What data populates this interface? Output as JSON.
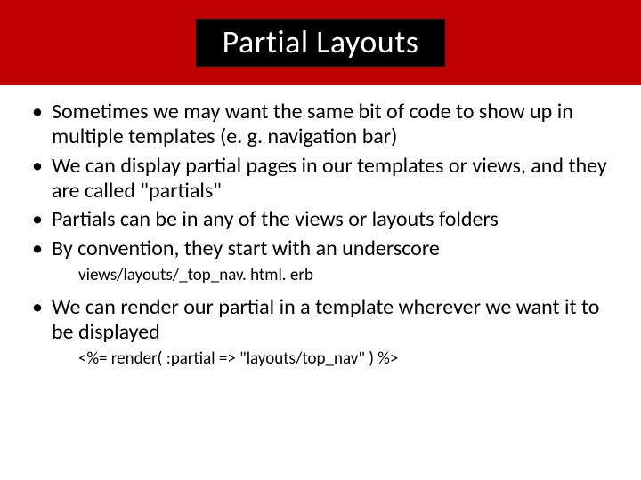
{
  "title": "Partial Layouts",
  "bullets": [
    {
      "text": "Sometimes we may want the same bit of code to show up in multiple templates (e. g. navigation bar)"
    },
    {
      "text": "We can display partial pages in our templates or views, and they are called \"partials\""
    },
    {
      "text": "Partials can be in any of the views or layouts folders"
    },
    {
      "text": "By convention, they start with an underscore",
      "sub": "views/layouts/_top_nav. html. erb"
    },
    {
      "text": "We can render our partial in a template wherever we want it to be displayed",
      "sub": "<%= render( :partial => \"layouts/top_nav\" ) %>"
    }
  ]
}
